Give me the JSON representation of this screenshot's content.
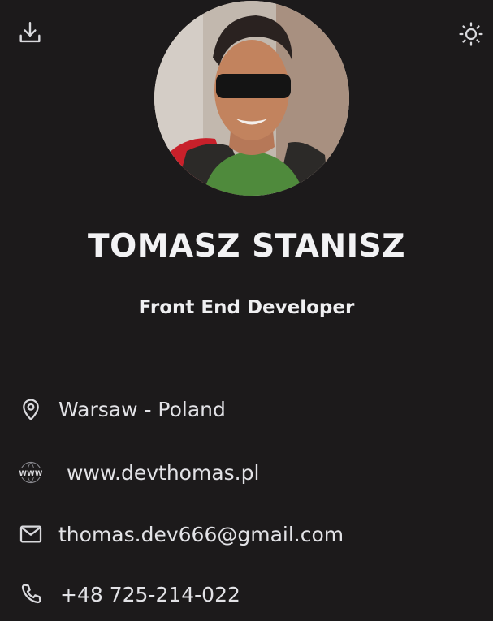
{
  "profile": {
    "name": "TOMASZ STANISZ",
    "role": "Front End Developer",
    "avatar_alt": "Tomasz Stanisz"
  },
  "contacts": {
    "location": "Warsaw - Poland",
    "website": "www.devthomas.pl",
    "email": "thomas.dev666@gmail.com",
    "phone": "+48 725-214-022"
  },
  "icons": {
    "download": "download-icon",
    "theme": "sun-icon",
    "location": "map-pin-icon",
    "website": "www-globe-icon",
    "email": "mail-icon",
    "phone": "phone-icon"
  },
  "colors": {
    "background": "#1c1a1b",
    "text": "#efeff1",
    "icon": "#d9d9dd"
  }
}
